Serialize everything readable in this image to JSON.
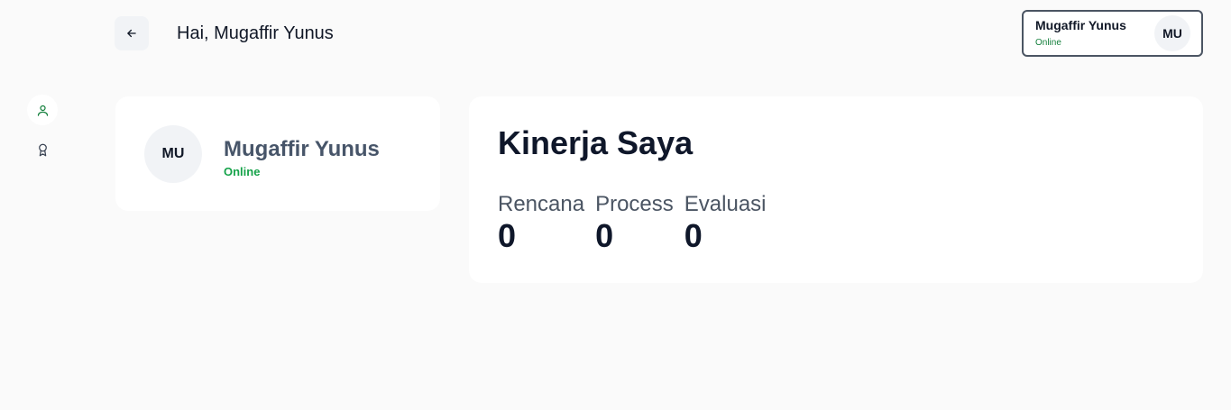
{
  "header": {
    "greeting": "Hai, Mugaffir Yunus"
  },
  "user_chip": {
    "name": "Mugaffir Yunus",
    "status": "Online",
    "initials": "MU"
  },
  "sidebar": {
    "items": [
      {
        "icon": "user-icon",
        "active": true
      },
      {
        "icon": "award-icon",
        "active": false
      }
    ]
  },
  "profile": {
    "initials": "MU",
    "name": "Mugaffir Yunus",
    "status": "Online"
  },
  "performance": {
    "title": "Kinerja Saya",
    "stats": [
      {
        "label": "Rencana",
        "value": "0"
      },
      {
        "label": "Process",
        "value": "0"
      },
      {
        "label": "Evaluasi",
        "value": "0"
      }
    ]
  },
  "colors": {
    "background": "#fafafa",
    "card": "#ffffff",
    "accent_green": "#16a34a",
    "chip_border": "#4b5563"
  }
}
